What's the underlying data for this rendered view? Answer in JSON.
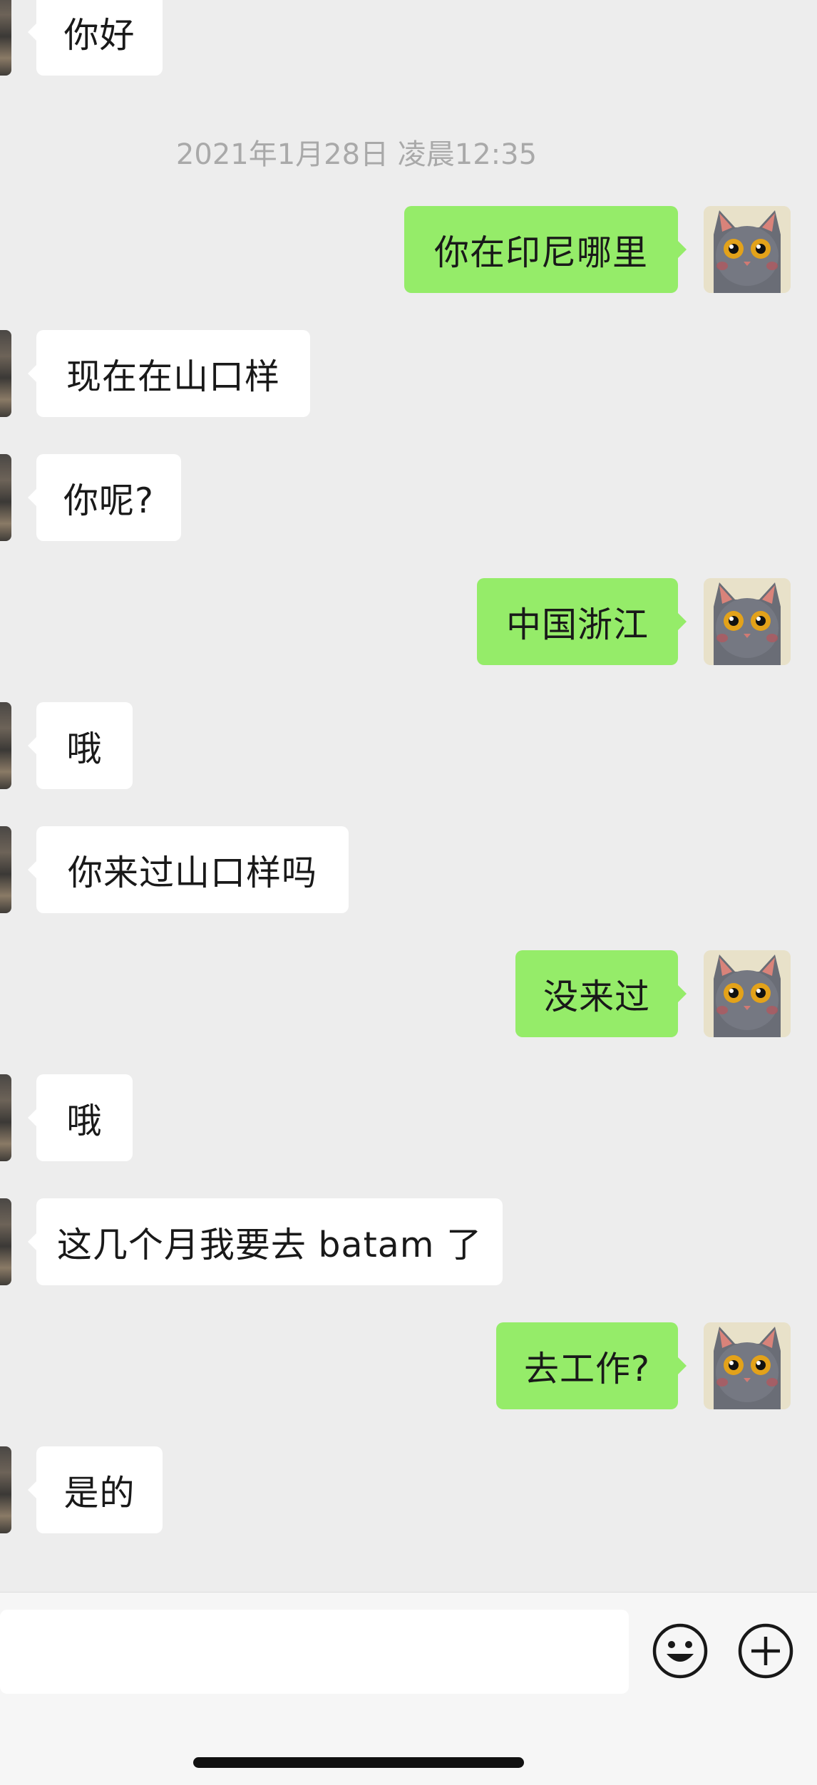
{
  "chat": {
    "timestamp": "2021年1月28日 凌晨12:35",
    "messages": [
      {
        "side": "in",
        "text": "你好"
      },
      {
        "side": "out",
        "text": "你在印尼哪里"
      },
      {
        "side": "in",
        "text": "现在在山口样"
      },
      {
        "side": "in",
        "text": "你呢?"
      },
      {
        "side": "out",
        "text": "中国浙江"
      },
      {
        "side": "in",
        "text": "哦"
      },
      {
        "side": "in",
        "text": "你来过山口样吗"
      },
      {
        "side": "out",
        "text": "没来过"
      },
      {
        "side": "in",
        "text": "哦"
      },
      {
        "side": "in",
        "text": "这几个月我要去 batam 了"
      },
      {
        "side": "out",
        "text": "去工作?"
      },
      {
        "side": "in",
        "text": "是的"
      }
    ]
  },
  "input_bar": {
    "input_value": "",
    "emoji_icon": "smiley-face-icon",
    "plus_icon": "plus-circle-icon"
  },
  "colors": {
    "background": "#ededed",
    "outgoing_bubble": "#95ec69",
    "incoming_bubble": "#ffffff",
    "timestamp_text": "#a9a9a9"
  }
}
